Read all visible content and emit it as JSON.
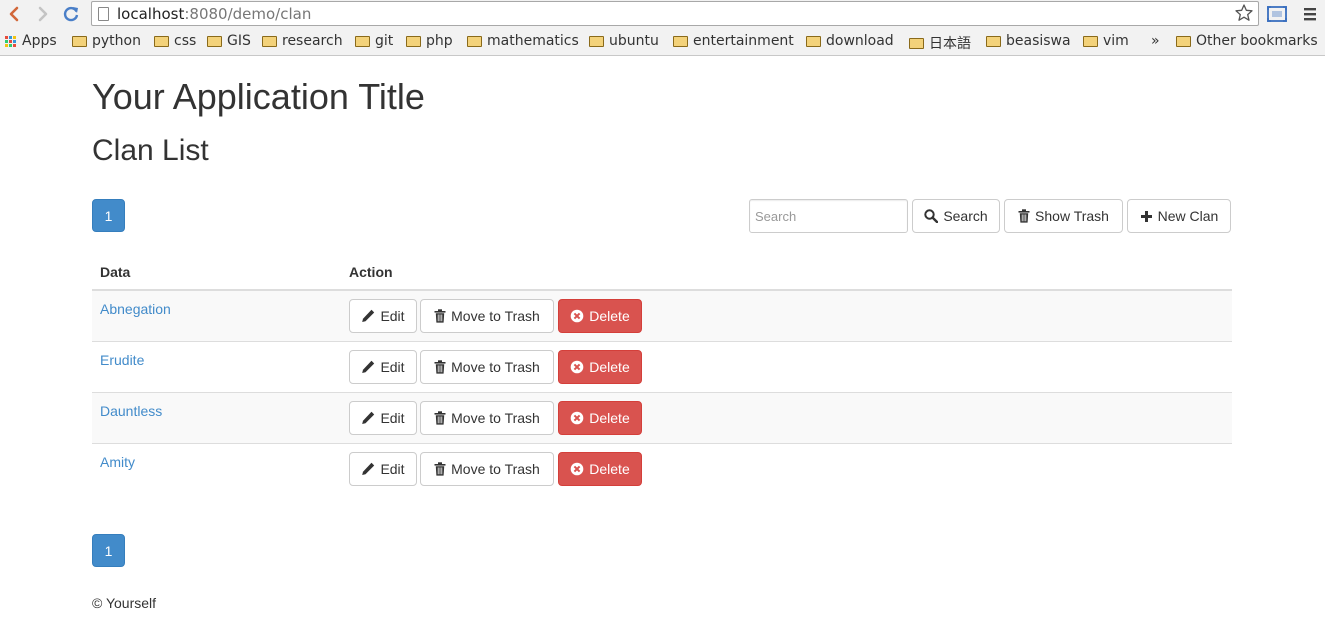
{
  "browser": {
    "url_host": "localhost",
    "url_path": ":8080/demo/clan",
    "bookmarks": [
      {
        "label": "Apps",
        "type": "apps"
      },
      {
        "label": "python",
        "type": "folder"
      },
      {
        "label": "css",
        "type": "folder"
      },
      {
        "label": "GIS",
        "type": "folder"
      },
      {
        "label": "research",
        "type": "folder"
      },
      {
        "label": "git",
        "type": "folder"
      },
      {
        "label": "php",
        "type": "folder"
      },
      {
        "label": "mathematics",
        "type": "folder"
      },
      {
        "label": "ubuntu",
        "type": "folder"
      },
      {
        "label": "entertainment",
        "type": "folder"
      },
      {
        "label": "download",
        "type": "folder"
      },
      {
        "label": "日本語",
        "type": "folder"
      },
      {
        "label": "beasiswa",
        "type": "folder"
      },
      {
        "label": "vim",
        "type": "folder"
      }
    ],
    "overflow_label": "»",
    "other_bookmarks": "Other bookmarks"
  },
  "page": {
    "app_title": "Your Application Title",
    "heading": "Clan List",
    "pagination_top": "1",
    "pagination_bottom": "1",
    "search_placeholder": "Search",
    "search_button": "Search",
    "show_trash_button": "Show Trash",
    "new_button": "New Clan",
    "footer": "© Yourself"
  },
  "table": {
    "headers": [
      "Data",
      "Action"
    ],
    "actions": {
      "edit": "Edit",
      "trash": "Move to Trash",
      "delete": "Delete"
    },
    "rows": [
      {
        "name": "Abnegation"
      },
      {
        "name": "Erudite"
      },
      {
        "name": "Dauntless"
      },
      {
        "name": "Amity"
      }
    ]
  },
  "colors": {
    "primary": "#428bca",
    "danger": "#d9534f",
    "link": "#428bca"
  }
}
